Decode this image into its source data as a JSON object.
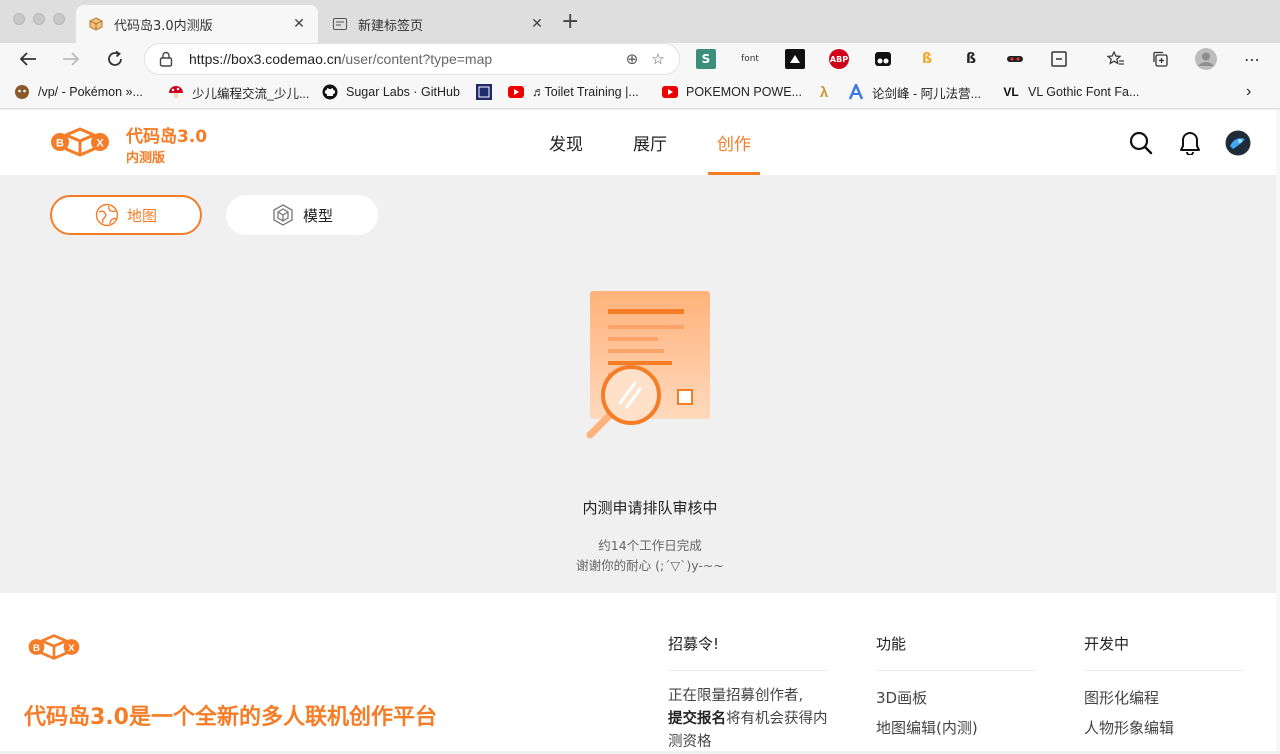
{
  "browser": {
    "tabs": [
      {
        "label": "代码岛3.0内测版",
        "active": true
      },
      {
        "label": "新建标签页",
        "active": false
      }
    ],
    "url": {
      "host": "https://box3.codemao.cn",
      "path": "/user/content?type=map"
    },
    "extensions": [
      {
        "name": "s-extension-icon",
        "label": "S"
      },
      {
        "name": "font-extension-icon",
        "label": "font"
      },
      {
        "name": "adobe-extension-icon",
        "label": ""
      },
      {
        "name": "adblock-extension-icon",
        "label": "ABP"
      },
      {
        "name": "tampermonkey-extension-icon",
        "label": ""
      },
      {
        "name": "script-extension-icon",
        "label": ""
      },
      {
        "name": "dark-script-extension-icon",
        "label": ""
      },
      {
        "name": "mask-extension-icon",
        "label": ""
      },
      {
        "name": "capture-extension-icon",
        "label": ""
      }
    ],
    "bookmarks": [
      {
        "label": "/vp/ - Pokémon »..."
      },
      {
        "label": "少儿编程交流_少儿..."
      },
      {
        "label": "Sugar Labs · GitHub"
      },
      {
        "label": ""
      },
      {
        "label": "♬Toilet Training |..."
      },
      {
        "label": "POKEMON POWE..."
      },
      {
        "label": ""
      },
      {
        "label": "论剑峰 - 阿儿法营..."
      },
      {
        "label": "VL Gothic Font Fa..."
      }
    ]
  },
  "site": {
    "brand": {
      "name": "代码岛3.0",
      "sub": "内测版"
    },
    "nav": [
      "发现",
      "展厅",
      "创作"
    ],
    "active_nav": "创作",
    "colors": {
      "accent": "#f57d28",
      "background": "#f0f0f0"
    },
    "tabs": [
      {
        "label": "地图",
        "active": true
      },
      {
        "label": "模型",
        "active": false
      }
    ],
    "empty": {
      "title": "内测申请排队审核中",
      "line1": "约14个工作日完成",
      "line2": "谢谢你的耐心 (;´▽`)y-~~"
    },
    "footer": {
      "slogan": "代码岛3.0是一个全新的多人联机创作平台",
      "columns": [
        {
          "title": "招募令!",
          "text_pre": "正在限量招募创作者,",
          "text_bold": "提交报名",
          "text_post": "将有机会获得内测资格"
        },
        {
          "title": "功能",
          "items": [
            "3D画板",
            "地图编辑(内测)"
          ]
        },
        {
          "title": "开发中",
          "items": [
            "图形化编程",
            "人物形象编辑"
          ]
        }
      ]
    }
  }
}
